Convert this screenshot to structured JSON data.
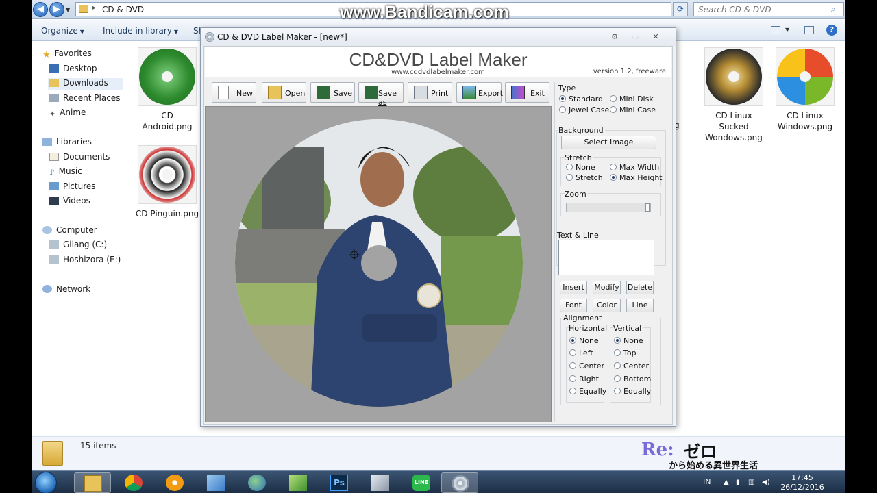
{
  "watermark": "www.Bandicam.com",
  "explorer": {
    "address": "CD & DVD",
    "search_placeholder": "Search CD & DVD",
    "commands": [
      "Organize",
      "Include in library",
      "Sh"
    ],
    "nav": {
      "favorites": "Favorites",
      "favorites_items": [
        "Desktop",
        "Downloads",
        "Recent Places",
        "Anime"
      ],
      "libraries": "Libraries",
      "libraries_items": [
        "Documents",
        "Music",
        "Pictures",
        "Videos"
      ],
      "computer": "Computer",
      "computer_items": [
        "Gilang (C:)",
        "Hoshizora (E:)"
      ],
      "network": "Network"
    },
    "files": [
      {
        "name": "CD Android.png",
        "line1": "CD",
        "line2": "Android.png",
        "thumb_color": "#2e8b2e"
      },
      {
        "name": "CD Pinguin.png",
        "line1": "CD Pinguin.png",
        "line2": "",
        "thumb_color": "#ffffff"
      },
      {
        "name": "CD Linux Sucked Wondows.png",
        "line1": "CD Linux",
        "line2": "Sucked",
        "line3": "Wondows.png",
        "thumb_color": "#222222"
      },
      {
        "name": "CD Linux Windows.png",
        "line1": "CD Linux",
        "line2": "Windows.png",
        "thumb_color": "#ffffff"
      }
    ],
    "partial_label": "g",
    "status": "15 items",
    "overlay_logo": {
      "re": "Re:",
      "zero": "ゼロ",
      "sub": "から始める異世界生活"
    }
  },
  "taskbar": {
    "lang": "IN",
    "time": "17:45",
    "date": "26/12/2016"
  },
  "app": {
    "window_title": "CD & DVD Label Maker - [new*]",
    "banner_title": "CD&DVD Label Maker",
    "banner_url": "www.cddvdlabelmaker.com",
    "version": "version 1.2, freeware",
    "toolbar": [
      "New",
      "Open",
      "Save",
      "Save as",
      "Print",
      "Export",
      "Exit"
    ],
    "type": {
      "label": "Type",
      "options": [
        "Standard",
        "Mini Disk",
        "Jewel Case",
        "Mini Case"
      ],
      "selected": "Standard"
    },
    "background": {
      "label": "Background",
      "select_image": "Select Image",
      "stretch_label": "Stretch",
      "stretch_options": [
        "None",
        "Max Width",
        "Stretch",
        "Max Height"
      ],
      "stretch_selected": "Max Height",
      "zoom_label": "Zoom",
      "zoom_value": 1.0
    },
    "text_line": {
      "label": "Text & Line",
      "buttons": [
        "Insert",
        "Modify",
        "Delete",
        "Font",
        "Color",
        "Line"
      ]
    },
    "alignment": {
      "label": "Alignment",
      "horizontal_label": "Horizontal",
      "horizontal_options": [
        "None",
        "Left",
        "Center",
        "Right",
        "Equally"
      ],
      "horizontal_selected": "None",
      "vertical_label": "Vertical",
      "vertical_options": [
        "None",
        "Top",
        "Center",
        "Bottom",
        "Equally"
      ],
      "vertical_selected": "None"
    }
  }
}
